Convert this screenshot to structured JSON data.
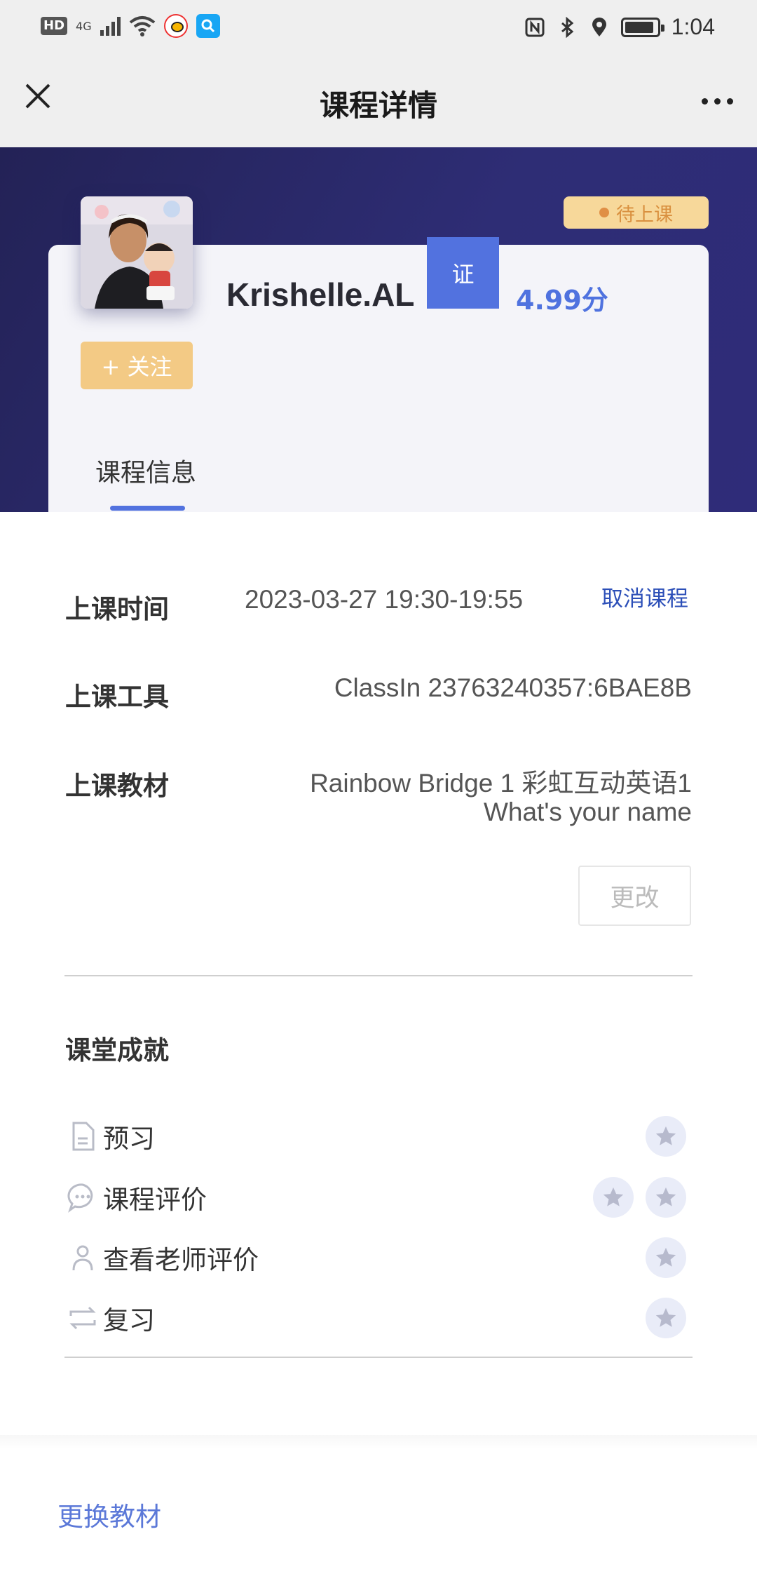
{
  "status_bar": {
    "hd_label": "HD",
    "network_label": "4G",
    "time": "1:04",
    "icons": [
      "hd-icon",
      "signal-icon",
      "wifi-icon",
      "weibo-icon",
      "search-app-icon",
      "nfc-icon",
      "bluetooth-icon",
      "location-icon",
      "battery-icon"
    ]
  },
  "nav": {
    "title": "课程详情",
    "close_icon": "close-icon",
    "more_icon": "more-icon"
  },
  "teacher": {
    "status_badge": "待上课",
    "name": "Krishelle.AL",
    "cert_badge": "证",
    "rating": "4.99分",
    "follow_label": "+ 关注"
  },
  "tabs": [
    {
      "label": "课程信息",
      "active": true
    }
  ],
  "course_info": {
    "time_label": "上课时间",
    "time_value": "2023-03-27 19:30-19:55",
    "cancel_label": "取消课程",
    "tool_label": "上课工具",
    "tool_value": "ClassIn 23763240357:6BAE8B",
    "material_label": "上课教材",
    "material_line1": "Rainbow Bridge 1 彩虹互动英语1",
    "material_line2": "What's your name",
    "change_label": "更改"
  },
  "achievements": {
    "title": "课堂成就",
    "items": [
      {
        "label": "预习",
        "icon": "document-icon",
        "stars": 1
      },
      {
        "label": "课程评价",
        "icon": "chat-icon",
        "stars": 2
      },
      {
        "label": "查看老师评价",
        "icon": "person-icon",
        "stars": 1
      },
      {
        "label": "复习",
        "icon": "repeat-icon",
        "stars": 1
      }
    ]
  },
  "footer": {
    "change_material_label": "更换教材"
  },
  "colors": {
    "accent": "#5272df",
    "hero_bg": "#2a2970",
    "badge_bg": "#f7d89a",
    "follow_bg": "#f3ca85",
    "link": "#2c4fb8"
  }
}
